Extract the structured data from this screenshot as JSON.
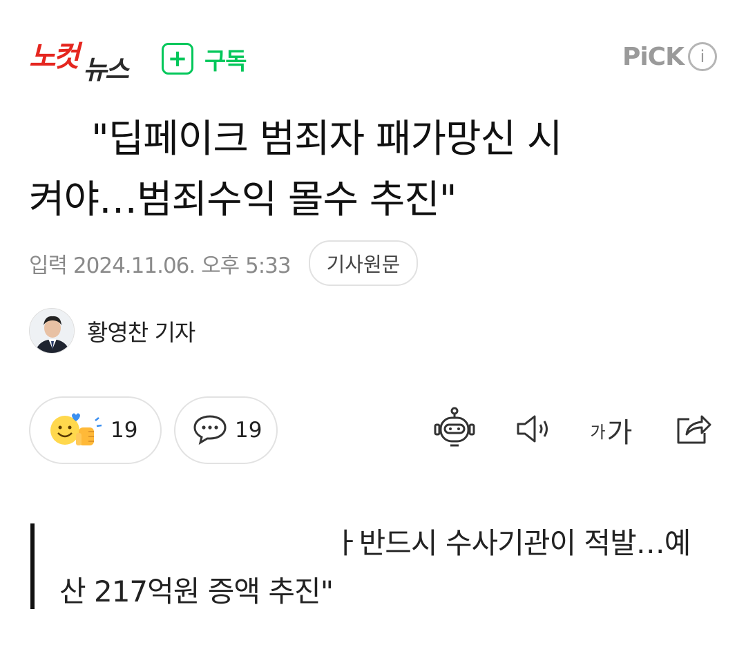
{
  "header": {
    "logo_part1": "노컷",
    "logo_part2": "뉴스",
    "subscribe_plus": "+",
    "subscribe_label": "구독",
    "pick_label": "PiCK",
    "info_glyph": "i"
  },
  "article": {
    "title_line1": "\"딥페이크 범죄자 패가망신 시",
    "title_line2": "켜야…범죄수익 몰수 추진\"",
    "date": "입력 2024.11.06. 오후 5:33",
    "original_button": "기사원문",
    "reporter": "황영찬 기자"
  },
  "reactions": {
    "like_count": "19",
    "comment_count": "19",
    "font_small": "가",
    "font_large": "가"
  },
  "quote": {
    "line1": "ㅏ반드시 수사기관이 적발…예",
    "line2": "산 217억원 증액 추진\""
  },
  "colors": {
    "brand_red": "#e5261f",
    "subscribe_green": "#03c75a",
    "muted_gray": "#8a8a8a"
  },
  "icons": [
    "plus-icon",
    "info-icon",
    "emoji-like-icon",
    "comment-icon",
    "ai-robot-icon",
    "speaker-icon",
    "font-size-icon",
    "share-icon"
  ]
}
